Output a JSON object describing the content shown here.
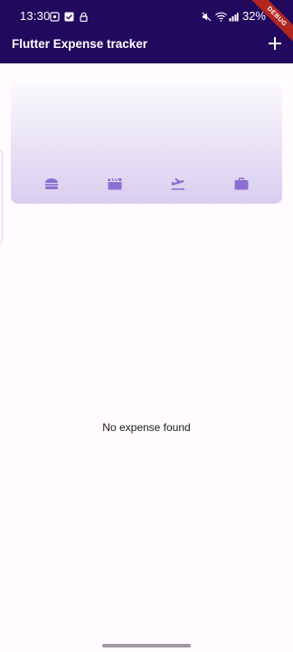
{
  "status_bar": {
    "time": "13:30",
    "battery": "32%",
    "left_icons": [
      "screenshot-icon",
      "checkbox-icon",
      "lock-icon"
    ],
    "right_icons": [
      "mute-icon",
      "wifi-icon",
      "signal-icon"
    ]
  },
  "app_bar": {
    "title": "Flutter Expense tracker",
    "action_icon": "add-icon",
    "background": "#23095e"
  },
  "debug_banner": "DEBUG",
  "chart": {
    "categories": [
      {
        "icon": "lunch-icon"
      },
      {
        "icon": "movie-icon"
      },
      {
        "icon": "flight-takeoff-icon"
      },
      {
        "icon": "work-icon"
      }
    ],
    "icon_color": "#8c6fd1"
  },
  "expenses": {
    "empty_message": "No expense found"
  }
}
